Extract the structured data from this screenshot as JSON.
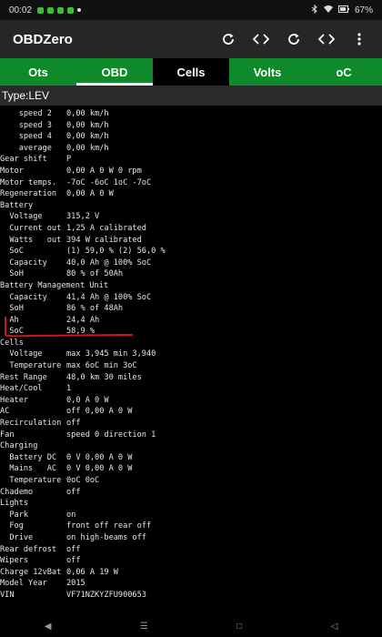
{
  "status": {
    "time": "00:02",
    "battery": "67%"
  },
  "app": {
    "title": "OBDZero",
    "icons": [
      "refresh-icon",
      "code-icon",
      "refresh-icon",
      "code-icon",
      "more-vert-icon"
    ]
  },
  "tabs": [
    "Ots",
    "OBD",
    "Cells",
    "Volts",
    "oC"
  ],
  "type_label": "Type:LEV",
  "rows": [
    {
      "k": "    speed 2",
      "v": "0,00 km/h"
    },
    {
      "k": "    speed 3",
      "v": "0,00 km/h"
    },
    {
      "k": "    speed 4",
      "v": "0,00 km/h"
    },
    {
      "k": "    average",
      "v": "0,00 km/h"
    },
    {
      "k": "Gear shift",
      "v": "P"
    },
    {
      "k": "Motor",
      "v": "0,00 A 0 W 0 rpm"
    },
    {
      "k": "Motor temps.",
      "v": "-7oC -6oC 1oC -7oC"
    },
    {
      "k": "Regeneration",
      "v": "0,00 A 0 W"
    },
    {
      "k": "Battery",
      "v": ""
    },
    {
      "k": "  Voltage",
      "v": "315,2 V"
    },
    {
      "k": "  Current out",
      "v": "1,25 A calibrated"
    },
    {
      "k": "  Watts   out",
      "v": "394 W calibrated"
    },
    {
      "k": "  SoC",
      "v": "(1) 59,0 % (2) 56,0 %"
    },
    {
      "k": "  Capacity",
      "v": "40,0 Ah @ 100% SoC"
    },
    {
      "k": "  SoH",
      "v": "80 % of 50Ah"
    },
    {
      "k": "Battery Management Unit",
      "v": ""
    },
    {
      "k": "  Capacity",
      "v": "41,4 Ah @ 100% SoC"
    },
    {
      "k": "  SoH",
      "v": "86 % of 48Ah"
    },
    {
      "k": "  Ah",
      "v": "24,4 Ah"
    },
    {
      "k": "  SoC",
      "v": "58,9 %"
    },
    {
      "k": "Cells",
      "v": ""
    },
    {
      "k": "  Voltage",
      "v": "max 3,945 min 3,940"
    },
    {
      "k": "  Temperature",
      "v": "max 6oC min 3oC"
    },
    {
      "k": "Rest Range",
      "v": "48,0 km 30 miles"
    },
    {
      "k": "Heat/Cool",
      "v": "1"
    },
    {
      "k": "Heater",
      "v": "0,0 A 0 W"
    },
    {
      "k": "AC",
      "v": "off 0,00 A 0 W"
    },
    {
      "k": "Recirculation",
      "v": "off"
    },
    {
      "k": "Fan",
      "v": "speed 0 direction 1"
    },
    {
      "k": "Charging",
      "v": ""
    },
    {
      "k": "  Battery DC",
      "v": "0 V 0,00 A 0 W"
    },
    {
      "k": "  Mains   AC",
      "v": "0 V 0,00 A 0 W"
    },
    {
      "k": "  Temperature",
      "v": "0oC 0oC"
    },
    {
      "k": "Chademo",
      "v": "off"
    },
    {
      "k": "Lights",
      "v": ""
    },
    {
      "k": "  Park",
      "v": "on"
    },
    {
      "k": "  Fog",
      "v": "front off rear off"
    },
    {
      "k": "  Drive",
      "v": "on high-beams off"
    },
    {
      "k": "Rear defrost",
      "v": "off"
    },
    {
      "k": "Wipers",
      "v": "off"
    },
    {
      "k": "Charge 12vBat",
      "v": "0,06 A 19 W"
    },
    {
      "k": "Model Year",
      "v": "2015"
    },
    {
      "k": "VIN",
      "v": "VF71NZKYZFU900653"
    }
  ],
  "colors": {
    "tab_green": "#0f8a2b",
    "annotation_red": "#d01818"
  }
}
